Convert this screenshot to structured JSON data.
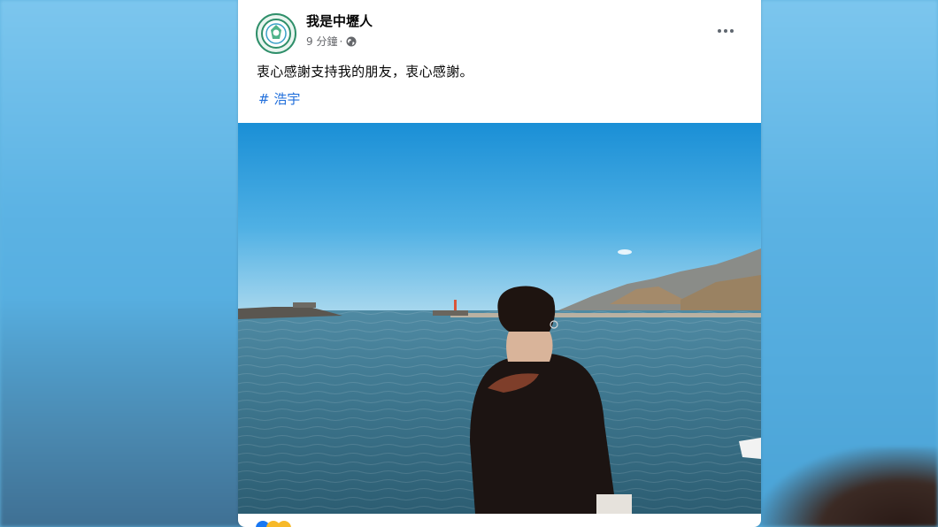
{
  "post": {
    "author": "我是中壢人",
    "time": "9 分鐘",
    "separator": "·",
    "privacy_icon": "globe-icon",
    "text": "衷心感謝支持我的朋友，衷心感謝。",
    "hashtag": "# 浩宇",
    "more_icon": "more-horizontal-icon"
  },
  "colors": {
    "link": "#216fdb",
    "text": "#050505",
    "meta": "#65676b",
    "avatar_ring": "#2f8f6a"
  }
}
